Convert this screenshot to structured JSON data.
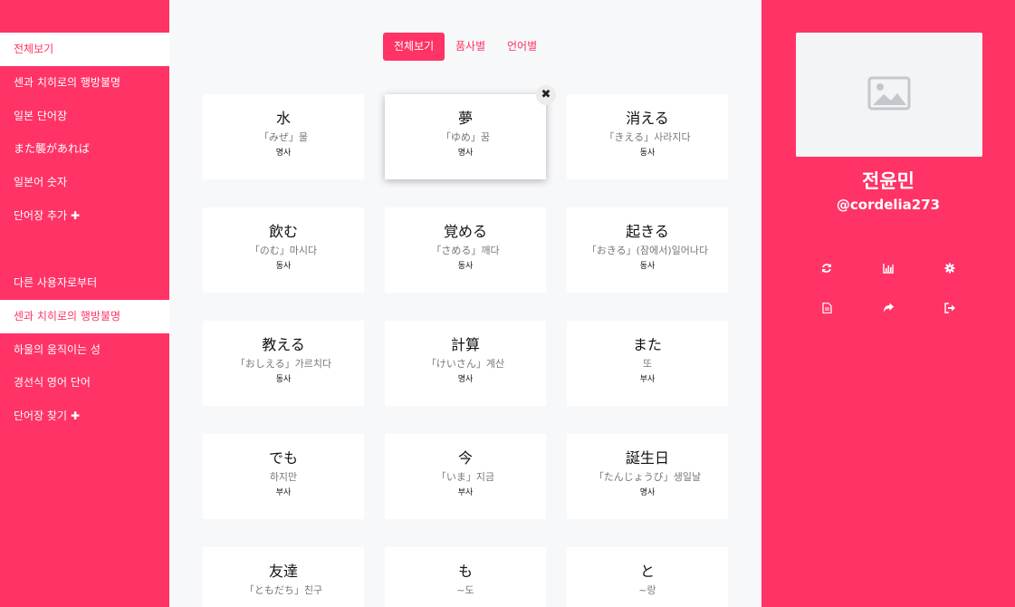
{
  "sidebar": {
    "my_lists": [
      {
        "label": "전체보기",
        "active": true
      },
      {
        "label": "센과 치히로의 행방불명",
        "active": false
      },
      {
        "label": "일본 단어장",
        "active": false
      },
      {
        "label": "また襲があれば",
        "active": false
      },
      {
        "label": "일본어 숫자",
        "active": false
      }
    ],
    "add_list_label": "단어장 추가",
    "other_header": "다른 사용자로부터",
    "other_lists": [
      {
        "label": "센과 치히로의 행방불명",
        "active": true
      },
      {
        "label": "하울의 움직이는 성",
        "active": false
      },
      {
        "label": "경선식 영어 단어",
        "active": false
      }
    ],
    "find_list_label": "단어장 찾기",
    "plus_glyph": "✚"
  },
  "tabs": [
    {
      "label": "전체보기",
      "active": true
    },
    {
      "label": "품사별",
      "active": false
    },
    {
      "label": "언어별",
      "active": false
    }
  ],
  "close_glyph": "✖",
  "cards": [
    {
      "word": "水",
      "reading": "「みぜ」물",
      "pos": "명사"
    },
    {
      "word": "夢",
      "reading": "「ゆめ」꿈",
      "pos": "명사",
      "focused": true
    },
    {
      "word": "消える",
      "reading": "「きえる」사라지다",
      "pos": "동사"
    },
    {
      "word": "飲む",
      "reading": "「のむ」마시다",
      "pos": "동사"
    },
    {
      "word": "覚める",
      "reading": "「さめる」깨다",
      "pos": "동사"
    },
    {
      "word": "起きる",
      "reading": "「おきる」(잠에서)일어나다",
      "pos": "동사"
    },
    {
      "word": "教える",
      "reading": "「おしえる」가르치다",
      "pos": "동사"
    },
    {
      "word": "計算",
      "reading": "「けいさん」계산",
      "pos": "명사"
    },
    {
      "word": "また",
      "reading": "또",
      "pos": "부사"
    },
    {
      "word": "でも",
      "reading": "하지만",
      "pos": "부사"
    },
    {
      "word": "今",
      "reading": "「いま」지금",
      "pos": "부사"
    },
    {
      "word": "誕生日",
      "reading": "「たんじょうび」생일날",
      "pos": "명사"
    },
    {
      "word": "友達",
      "reading": "「ともだち」친구",
      "pos": ""
    },
    {
      "word": "も",
      "reading": "~도",
      "pos": ""
    },
    {
      "word": "と",
      "reading": "~랑",
      "pos": ""
    }
  ],
  "profile": {
    "name": "전윤민",
    "handle": "@cordelia273",
    "avatar_icon": "image-placeholder-icon",
    "actions": [
      "refresh-icon",
      "bar-chart-icon",
      "gear-icon",
      "document-icon",
      "share-icon",
      "logout-icon"
    ]
  },
  "colors": {
    "accent": "#ff3366",
    "background": "#f7f8fa",
    "card": "#ffffff"
  }
}
